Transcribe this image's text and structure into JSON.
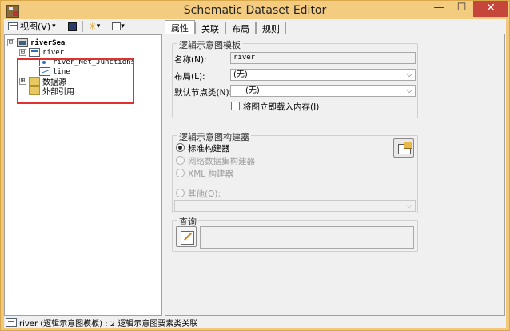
{
  "window": {
    "title": "Schematic Dataset Editor"
  },
  "toolbar": {
    "view_label": "视图(V)",
    "dropdown_arrow": "▾"
  },
  "tree": {
    "root": "riverSea",
    "items": [
      {
        "label": "river",
        "expander": "⊟"
      },
      {
        "label": "river_Net_Junctions"
      },
      {
        "label": "line"
      },
      {
        "label": "数据源",
        "expander": "⊞"
      },
      {
        "label": "外部引用"
      }
    ],
    "root_expander": "⊟"
  },
  "tabs": [
    {
      "label": "属性",
      "active": true
    },
    {
      "label": "关联",
      "active": false
    },
    {
      "label": "布局",
      "active": false
    },
    {
      "label": "规则",
      "active": false
    }
  ],
  "template_group": {
    "title": "逻辑示意图模板",
    "name_label": "名称(N):",
    "name_value": "river",
    "layout_label": "布局(L):",
    "layout_value": "(无)",
    "default_node_label": "默认节点类(N):",
    "default_node_value": "(无)",
    "load_in_memory_label": "将图立即载入内存(I)",
    "load_in_memory_checked": false
  },
  "builder_group": {
    "title": "逻辑示意图构建器",
    "options": [
      {
        "label": "标准构建器",
        "checked": true,
        "enabled": true
      },
      {
        "label": "网络数据集构建器",
        "checked": false,
        "enabled": false
      },
      {
        "label": "XML 构建器",
        "checked": false,
        "enabled": false
      },
      {
        "label": "其他(O):",
        "checked": false,
        "enabled": false
      }
    ],
    "other_value": ""
  },
  "query_group": {
    "title": "查询"
  },
  "status": {
    "text": "river (逻辑示意图模板) : 2 逻辑示意图要素类关联"
  },
  "window_buttons": {
    "min": "—",
    "max": "☐",
    "close": "✕"
  }
}
